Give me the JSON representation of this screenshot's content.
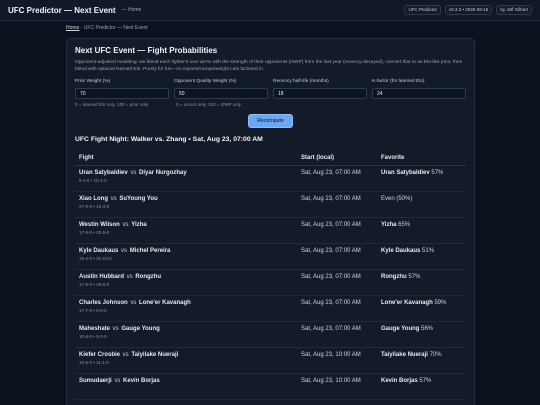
{
  "header": {
    "title": "UFC Predictor — Next Event",
    "home": "— Home",
    "brand": "UFC Predictor",
    "version": "v0.3.3 • 2025-08-16",
    "author": "by Jeff Gilbert"
  },
  "breadcrumb": {
    "home": "Home",
    "rest": " · UFC Predictor — Next Event"
  },
  "card": {
    "title": "Next UFC Event — Fight Probabilities",
    "description": "Opponent-adjusted modeling: we blend each fighter's own win% with the strength of their opponents (OWP) from the last year (recency-decayed), convert that to an Elo-like prior, then blend with optional learned Elo. Purely for fun—no injuries/camps/weight cuts factored in."
  },
  "params": [
    {
      "label": "Prior Weight (%)",
      "value": "70",
      "hint": "0 = learned Elo only, 100 = prior only"
    },
    {
      "label": "Opponent Quality Weight (%)",
      "value": "50",
      "hint": "0 = record only, 100 = OWP only"
    },
    {
      "label": "Recency half-life (months)",
      "value": "18",
      "hint": ""
    },
    {
      "label": "K-factor (for learned Elo)",
      "value": "24",
      "hint": ""
    }
  ],
  "recompute_label": "Recompute",
  "event_title": "UFC Fight Night: Walker vs. Zhang • Sat, Aug 23, 07:00 AM",
  "table": {
    "headers": {
      "fight": "Fight",
      "start": "Start (local)",
      "favorite": "Favorite"
    },
    "rows": [
      {
        "a": "Uran Satybaldiev",
        "b": "Diyar Nurgozhay",
        "record": "8-1-0 • 10-1-0",
        "start": "Sat, Aug 23, 07:00 AM",
        "fav": "Uran Satybaldiev",
        "pct": "57%"
      },
      {
        "a": "Xiao Long",
        "b": "SuYoung You",
        "record": "27-9-0 • 15-3-0",
        "start": "Sat, Aug 23, 07:00 AM",
        "fav": "",
        "pct": "Even (50%)"
      },
      {
        "a": "Westin Wilson",
        "b": "Yizha",
        "record": "17-9-0 • 25-5-0",
        "start": "Sat, Aug 23, 07:00 AM",
        "fav": "Yizha",
        "pct": "65%"
      },
      {
        "a": "Kyle Daukaus",
        "b": "Michel Pereira",
        "record": "15-4-0 • 31-13-0",
        "start": "Sat, Aug 23, 07:00 AM",
        "fav": "Kyle Daukaus",
        "pct": "51%"
      },
      {
        "a": "Austin Hubbard",
        "b": "Rongzhu",
        "record": "17-9-0 • 28-6-0",
        "start": "Sat, Aug 23, 07:00 AM",
        "fav": "Rongzhu",
        "pct": "57%"
      },
      {
        "a": "Charles Johnson",
        "b": "Lone'er Kavanagh",
        "record": "17-7-0 • 9-0-0",
        "start": "Sat, Aug 23, 07:00 AM",
        "fav": "Lone'er Kavanagh",
        "pct": "59%"
      },
      {
        "a": "Maheshate",
        "b": "Gauge Young",
        "record": "10-6-0 • 9-3-0",
        "start": "Sat, Aug 23, 07:00 AM",
        "fav": "Gauge Young",
        "pct": "56%"
      },
      {
        "a": "Kiefer Crosbie",
        "b": "Taiyilake Nueraji",
        "record": "10-5-0 • 11-1-0",
        "start": "Sat, Aug 23, 10:00 AM",
        "fav": "Taiyilake Nueraji",
        "pct": "70%"
      },
      {
        "a": "Sumudaerji",
        "b": "Kevin Borjas",
        "record": "",
        "start": "Sat, Aug 23, 10:00 AM",
        "fav": "Kevin Borjas",
        "pct": "57%"
      }
    ]
  }
}
